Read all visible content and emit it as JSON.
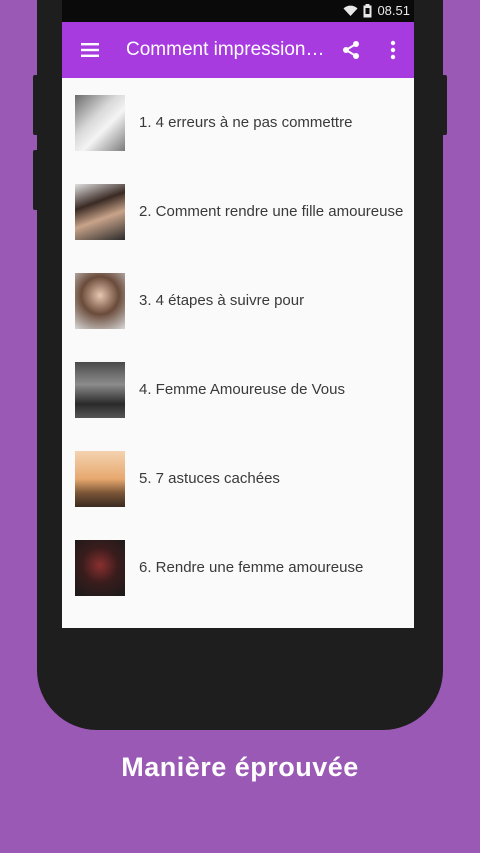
{
  "status_bar": {
    "time": "08.51",
    "icons": [
      "wifi-icon",
      "battery-icon"
    ]
  },
  "app_bar": {
    "title": "Comment impressionne...",
    "menu_icon": "hamburger-menu-icon",
    "share_icon": "share-icon",
    "overflow_icon": "more-vert-icon"
  },
  "list": {
    "items": [
      {
        "label": "1. 4 erreurs à ne pas commettre"
      },
      {
        "label": "2. Comment rendre une fille amoureuse"
      },
      {
        "label": "3. 4 étapes à suivre pour"
      },
      {
        "label": "4. Femme Amoureuse de Vous"
      },
      {
        "label": "5. 7 astuces cachées"
      },
      {
        "label": "6. Rendre une femme amoureuse"
      }
    ]
  },
  "caption": "Manière éprouvée",
  "colors": {
    "background": "#9b59b6",
    "app_bar": "#a83be0",
    "phone_frame": "#1e1e1e"
  }
}
